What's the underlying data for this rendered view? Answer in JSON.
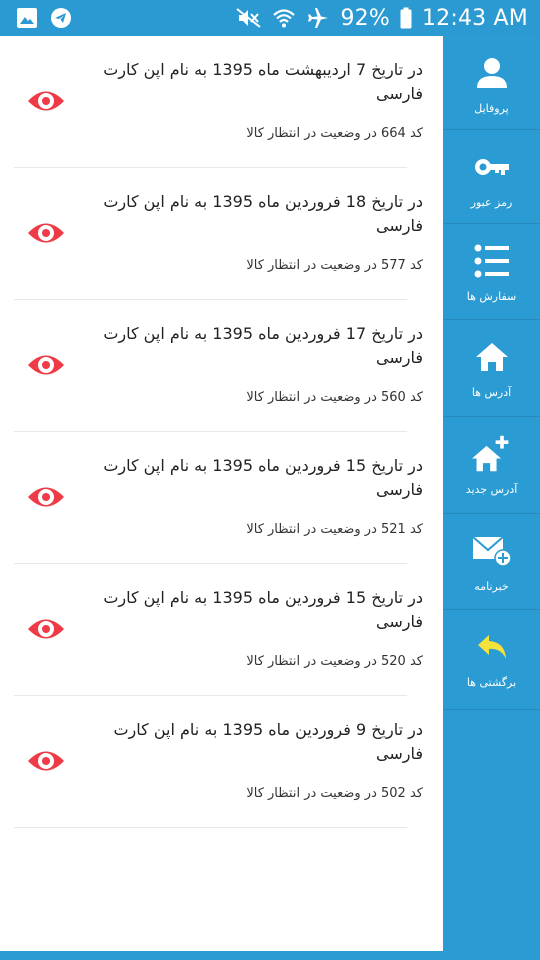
{
  "status_bar": {
    "battery": "92%",
    "time": "12:43 AM",
    "icons": [
      "gallery-icon",
      "telegram-icon",
      "mute-icon",
      "wifi-icon",
      "airplane-icon",
      "battery-icon"
    ]
  },
  "sidebar": {
    "items": [
      {
        "label": "پروفایل",
        "icon": "user-icon"
      },
      {
        "label": "رمز عبور",
        "icon": "key-icon"
      },
      {
        "label": "سفارش ها",
        "icon": "list-icon"
      },
      {
        "label": "آدرس ها",
        "icon": "home-icon"
      },
      {
        "label": "آدرس جدید",
        "icon": "home-add-icon"
      },
      {
        "label": "خبرنامه",
        "icon": "mail-add-icon"
      },
      {
        "label": "برگشتی ها",
        "icon": "reply-icon"
      }
    ]
  },
  "orders": [
    {
      "title": "در تاریخ 7 اردیبهشت ماه  1395 به نام اپن کارت فارسی",
      "status": "کد 664 در وضعیت در انتظار کالا"
    },
    {
      "title": "در تاریخ 18 فروردین ماه  1395 به نام اپن کارت فارسی",
      "status": "کد 577 در وضعیت در انتظار کالا"
    },
    {
      "title": "در تاریخ 17 فروردین ماه  1395 به نام اپن کارت فارسی",
      "status": "کد 560 در وضعیت در انتظار کالا"
    },
    {
      "title": "در تاریخ 15 فروردین ماه  1395 به نام اپن کارت فارسی",
      "status": "کد 521 در وضعیت در انتظار کالا"
    },
    {
      "title": "در تاریخ 15 فروردین ماه  1395 به نام اپن کارت فارسی",
      "status": "کد 520 در وضعیت در انتظار کالا"
    },
    {
      "title": "در تاریخ 9 فروردین ماه  1395 به نام اپن کارت فارسی",
      "status": "کد 502 در وضعیت در انتظار کالا"
    }
  ],
  "colors": {
    "primary": "#2b9bd3",
    "view_icon": "#ee3b47",
    "reply_icon": "#f5e33c",
    "content_bg": "#ffffff"
  }
}
